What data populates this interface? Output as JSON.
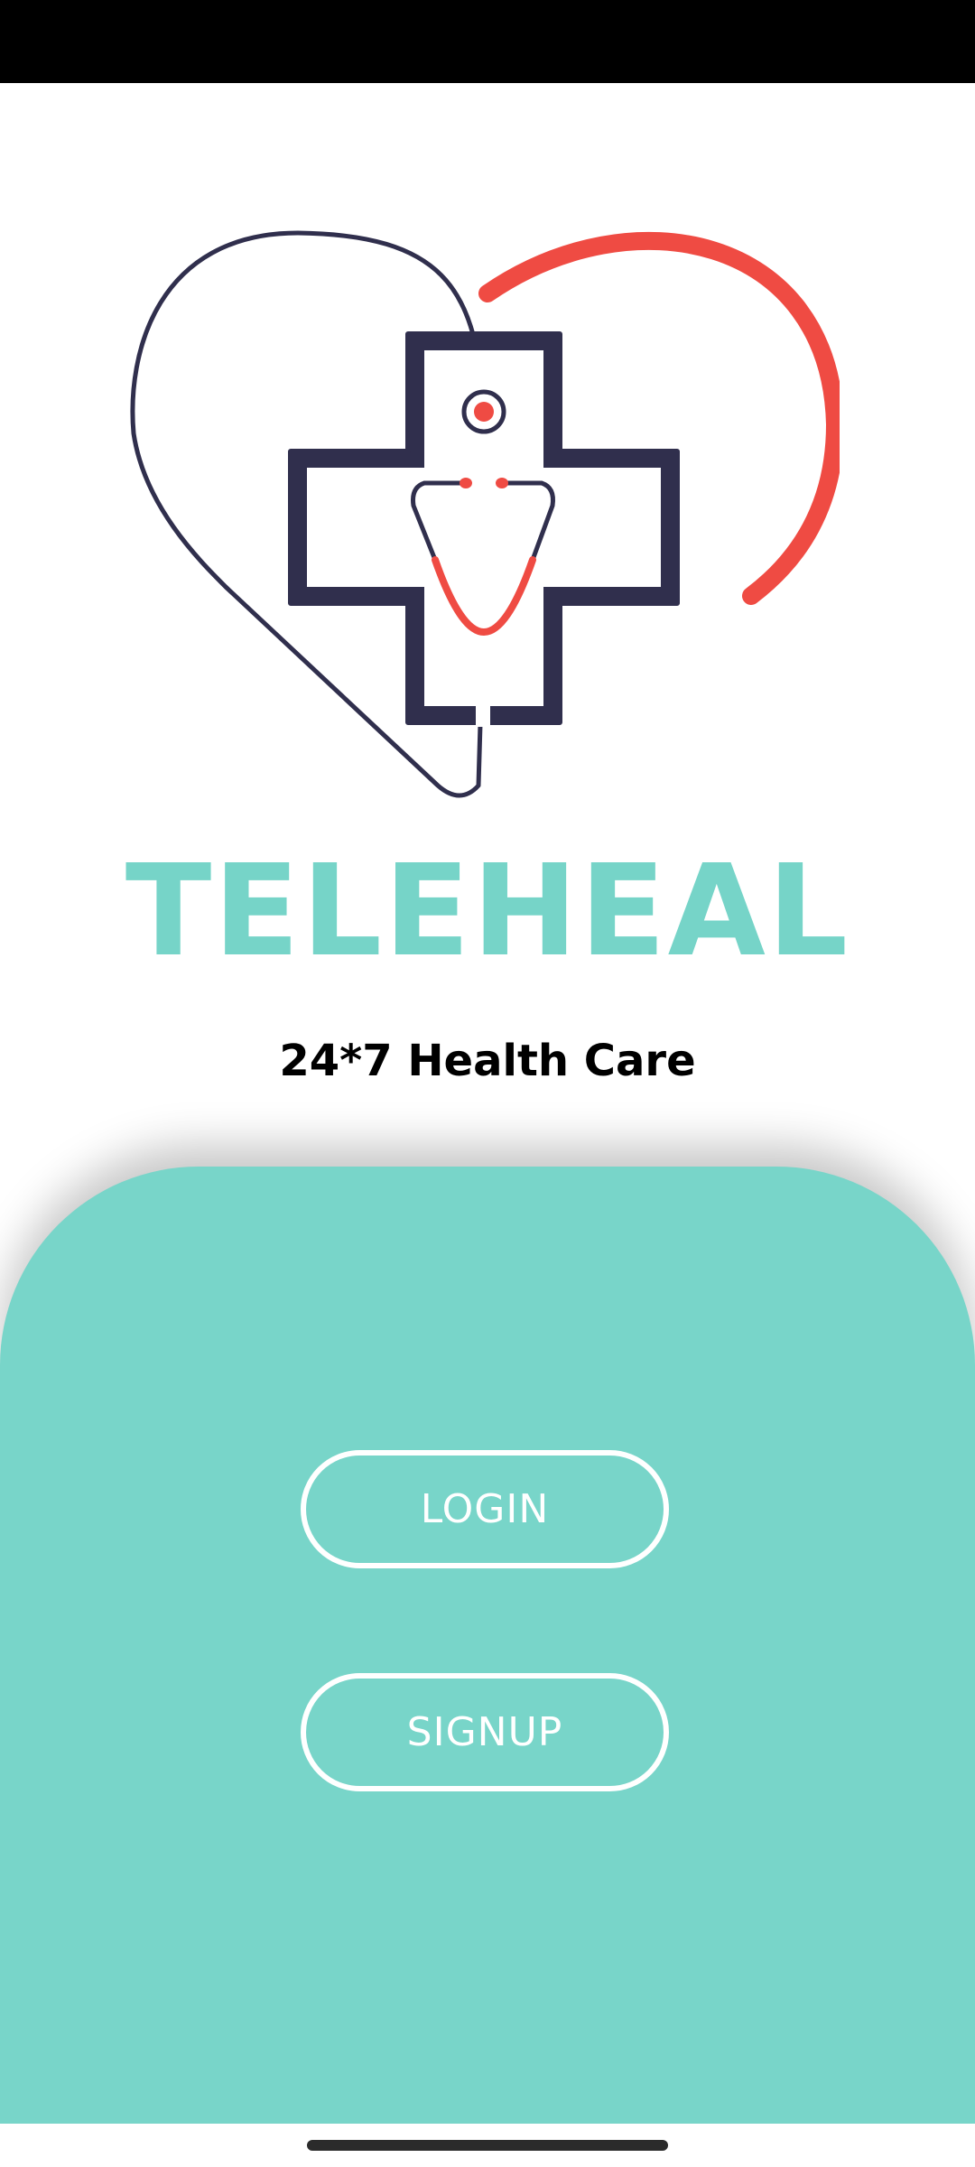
{
  "app": {
    "title": "TELEHEAL",
    "tagline": "24*7 Health Care"
  },
  "actions": {
    "login_label": "LOGIN",
    "signup_label": "SIGNUP"
  },
  "logo": {
    "icon": "heart-cross-stethoscope-logo",
    "colors": {
      "navy": "#302f4d",
      "red": "#ef4b43"
    }
  },
  "theme": {
    "accent": "#78d5c9",
    "text": "#000000",
    "background": "#ffffff"
  }
}
